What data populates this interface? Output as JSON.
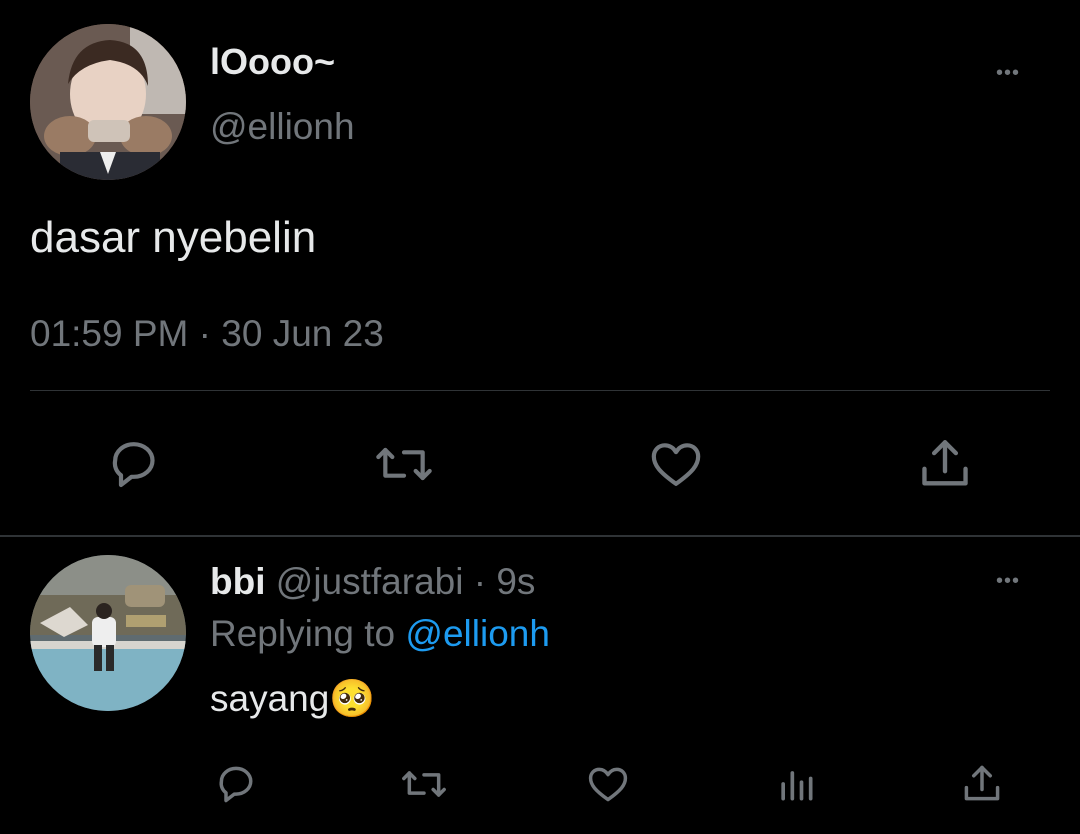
{
  "main_tweet": {
    "display_name": "lOooo~",
    "handle": "@ellionh",
    "text": "dasar nyebelin",
    "time": "01:59 PM",
    "separator": "·",
    "date": "30 Jun 23",
    "more_label": "•••"
  },
  "reply_tweet": {
    "display_name": "bbi",
    "handle": "@justfarabi",
    "separator": "·",
    "age": "9s",
    "replying_prefix": "Replying to",
    "replying_handle": "@ellionh",
    "text": "sayang",
    "emoji": "🥺",
    "more_label": "•••"
  },
  "icons": {
    "reply": "speech-bubble-icon",
    "retweet": "retweet-icon",
    "like": "heart-icon",
    "share": "share-upload-icon",
    "analytics": "bar-chart-icon"
  },
  "colors": {
    "background": "#000000",
    "text": "#e7e9ea",
    "muted": "#71767b",
    "link": "#1d9bf0",
    "divider": "#2f3336"
  }
}
